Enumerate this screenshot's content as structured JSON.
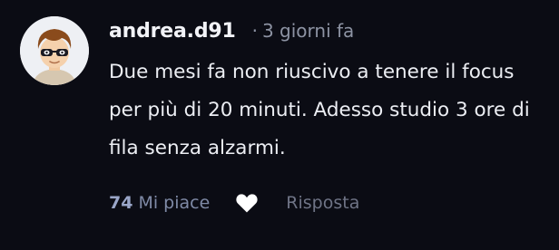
{
  "comment": {
    "username": "andrea.d91",
    "separator": "·",
    "timestamp": "3 giorni fa",
    "avatar_icon": "cartoon-avatar-sunglasses",
    "body": "Due mesi fa non riuscivo a tenere il focus per più di 20 minuti. Adesso studio 3 ore di fila senza alzarmi.",
    "likes_count": "74",
    "likes_label": "Mi piace",
    "like_icon": "heart-icon",
    "reply_label": "Risposta"
  },
  "colors": {
    "background": "#0b0c14",
    "username": "#f2f3f7",
    "muted": "#8d93a3",
    "likes": "#9aa6c8",
    "heart": "#ffffff"
  }
}
